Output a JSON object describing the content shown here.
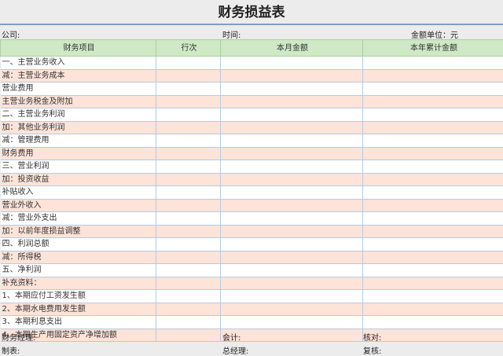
{
  "title": "财务损益表",
  "meta": {
    "company": "公司:",
    "time": "时间:",
    "unit": "金额单位：元"
  },
  "columns": [
    "财务项目",
    "行次",
    "本月金额",
    "本年累计金额"
  ],
  "rows": [
    "一、主营业务收入",
    "减：主营业务成本",
    "营业费用",
    "主营业务税金及附加",
    "二、主营业务利润",
    "加：其他业务利润",
    "减：管理费用",
    "财务费用",
    "三、营业利润",
    "加：投资收益",
    "补贴收入",
    "营业外收入",
    "减：营业外支出",
    "加：以前年度损益调整",
    "四、利润总额",
    "减：所得税",
    "五、净利润",
    "补充资料：",
    "1、本期应付工资发生额",
    "2、本期水电费用发生额",
    "3、本期利息支出",
    "4、本期生产用固定资产净增加额"
  ],
  "footer": {
    "line1": [
      "财务经理:",
      "会计:",
      "核对:"
    ],
    "line2": [
      "制表:",
      "总经理:",
      "复核:"
    ]
  }
}
